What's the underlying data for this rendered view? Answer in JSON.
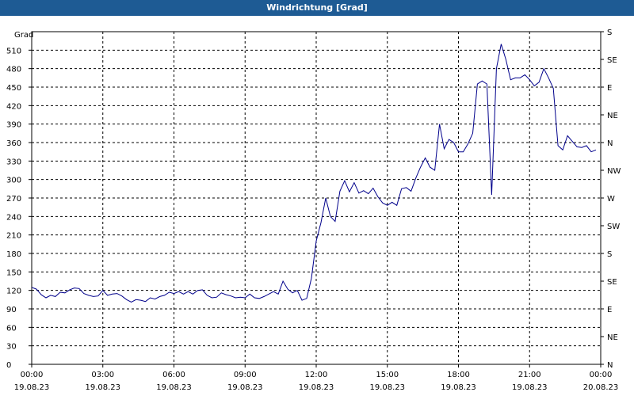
{
  "window": {
    "title": "Windrichtung [Grad]"
  },
  "chart_data": {
    "type": "line",
    "title": "Windrichtung [Grad]",
    "ylabel": "Grad",
    "xlabel": "",
    "ylim": [
      0,
      540
    ],
    "y_ticks": [
      0,
      30,
      60,
      90,
      120,
      150,
      180,
      210,
      240,
      270,
      300,
      330,
      360,
      390,
      420,
      450,
      480,
      510
    ],
    "xlim_hours": [
      0,
      24
    ],
    "x_ticks": [
      {
        "time": "00:00",
        "date": "19.08.23"
      },
      {
        "time": "03:00",
        "date": "19.08.23"
      },
      {
        "time": "06:00",
        "date": "19.08.23"
      },
      {
        "time": "09:00",
        "date": "19.08.23"
      },
      {
        "time": "12:00",
        "date": "19.08.23"
      },
      {
        "time": "15:00",
        "date": "19.08.23"
      },
      {
        "time": "18:00",
        "date": "19.08.23"
      },
      {
        "time": "21:00",
        "date": "19.08.23"
      },
      {
        "time": "00:00",
        "date": "20.08.23"
      }
    ],
    "right_axis": [
      {
        "value": 0,
        "label": "N"
      },
      {
        "value": 45,
        "label": "NE"
      },
      {
        "value": 90,
        "label": "E"
      },
      {
        "value": 135,
        "label": "SE"
      },
      {
        "value": 180,
        "label": "S"
      },
      {
        "value": 225,
        "label": "SW"
      },
      {
        "value": 270,
        "label": "W"
      },
      {
        "value": 315,
        "label": "NW"
      },
      {
        "value": 360,
        "label": "N"
      },
      {
        "value": 405,
        "label": "NE"
      },
      {
        "value": 450,
        "label": "E"
      },
      {
        "value": 495,
        "label": "SE"
      },
      {
        "value": 540,
        "label": "S"
      }
    ],
    "grid": true,
    "series": [
      {
        "color": "#00008b",
        "points": [
          [
            0.0,
            125
          ],
          [
            0.2,
            122
          ],
          [
            0.4,
            113
          ],
          [
            0.6,
            108
          ],
          [
            0.8,
            112
          ],
          [
            1.0,
            110
          ],
          [
            1.2,
            117
          ],
          [
            1.4,
            116
          ],
          [
            1.6,
            121
          ],
          [
            1.8,
            124
          ],
          [
            2.0,
            123
          ],
          [
            2.2,
            115
          ],
          [
            2.4,
            112
          ],
          [
            2.6,
            110
          ],
          [
            2.8,
            111
          ],
          [
            3.0,
            120
          ],
          [
            3.2,
            112
          ],
          [
            3.4,
            114
          ],
          [
            3.6,
            115
          ],
          [
            3.8,
            111
          ],
          [
            4.0,
            105
          ],
          [
            4.2,
            101
          ],
          [
            4.4,
            105
          ],
          [
            4.6,
            104
          ],
          [
            4.8,
            102
          ],
          [
            5.0,
            108
          ],
          [
            5.2,
            106
          ],
          [
            5.4,
            110
          ],
          [
            5.6,
            112
          ],
          [
            5.8,
            117
          ],
          [
            6.0,
            115
          ],
          [
            6.2,
            118
          ],
          [
            6.4,
            114
          ],
          [
            6.6,
            118
          ],
          [
            6.8,
            114
          ],
          [
            7.0,
            120
          ],
          [
            7.2,
            121
          ],
          [
            7.4,
            112
          ],
          [
            7.6,
            108
          ],
          [
            7.8,
            109
          ],
          [
            8.0,
            116
          ],
          [
            8.2,
            113
          ],
          [
            8.4,
            111
          ],
          [
            8.6,
            108
          ],
          [
            8.8,
            109
          ],
          [
            9.0,
            108
          ],
          [
            9.2,
            114
          ],
          [
            9.4,
            108
          ],
          [
            9.6,
            107
          ],
          [
            9.8,
            110
          ],
          [
            10.0,
            114
          ],
          [
            10.2,
            118
          ],
          [
            10.4,
            114
          ],
          [
            10.6,
            135
          ],
          [
            10.8,
            122
          ],
          [
            11.0,
            116
          ],
          [
            11.2,
            120
          ],
          [
            11.4,
            104
          ],
          [
            11.6,
            107
          ],
          [
            11.8,
            140
          ],
          [
            12.0,
            200
          ],
          [
            12.2,
            230
          ],
          [
            12.4,
            270
          ],
          [
            12.6,
            240
          ],
          [
            12.8,
            232
          ],
          [
            13.0,
            281
          ],
          [
            13.2,
            298
          ],
          [
            13.4,
            280
          ],
          [
            13.6,
            295
          ],
          [
            13.8,
            278
          ],
          [
            14.0,
            282
          ],
          [
            14.2,
            277
          ],
          [
            14.4,
            286
          ],
          [
            14.6,
            272
          ],
          [
            14.8,
            262
          ],
          [
            15.0,
            258
          ],
          [
            15.2,
            263
          ],
          [
            15.4,
            258
          ],
          [
            15.6,
            285
          ],
          [
            15.8,
            287
          ],
          [
            16.0,
            281
          ],
          [
            16.2,
            302
          ],
          [
            16.4,
            320
          ],
          [
            16.6,
            335
          ],
          [
            16.8,
            320
          ],
          [
            17.0,
            315
          ],
          [
            17.2,
            390
          ],
          [
            17.4,
            350
          ],
          [
            17.6,
            365
          ],
          [
            17.8,
            360
          ],
          [
            18.0,
            345
          ],
          [
            18.2,
            345
          ],
          [
            18.4,
            358
          ],
          [
            18.6,
            375
          ],
          [
            18.8,
            455
          ],
          [
            19.0,
            460
          ],
          [
            19.2,
            455
          ],
          [
            19.4,
            275
          ],
          [
            19.6,
            480
          ],
          [
            19.8,
            520
          ],
          [
            20.0,
            495
          ],
          [
            20.2,
            462
          ],
          [
            20.4,
            465
          ],
          [
            20.6,
            465
          ],
          [
            20.8,
            470
          ],
          [
            21.0,
            462
          ],
          [
            21.2,
            452
          ],
          [
            21.4,
            458
          ],
          [
            21.6,
            480
          ],
          [
            21.8,
            465
          ],
          [
            22.0,
            448
          ],
          [
            22.2,
            355
          ],
          [
            22.4,
            348
          ],
          [
            22.6,
            371
          ],
          [
            22.8,
            362
          ],
          [
            23.0,
            353
          ],
          [
            23.2,
            352
          ],
          [
            23.4,
            355
          ],
          [
            23.6,
            345
          ],
          [
            23.8,
            348
          ]
        ]
      }
    ]
  }
}
